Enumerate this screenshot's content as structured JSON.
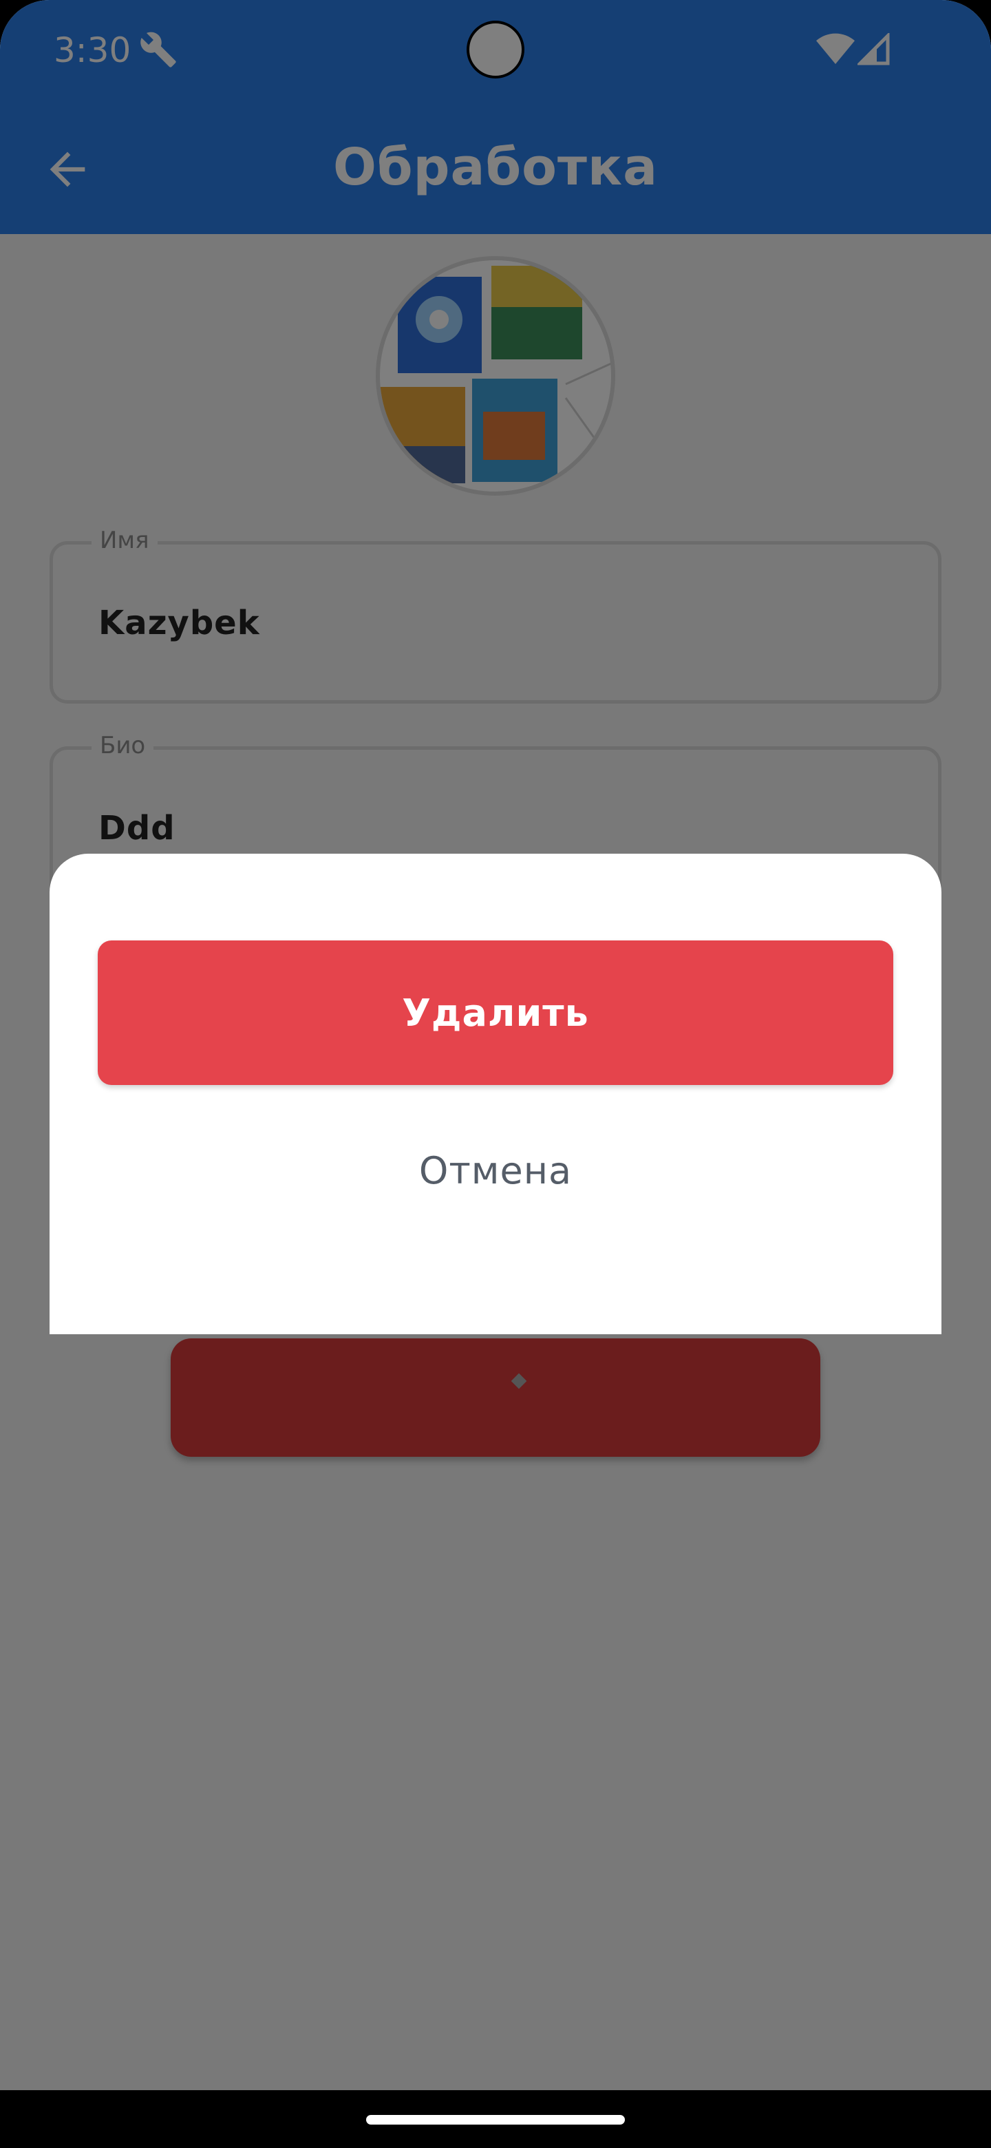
{
  "status_bar": {
    "time": "3:30",
    "icons": [
      "wrench-icon",
      "wifi-icon",
      "signal-icon"
    ]
  },
  "app_bar": {
    "title": "Обработка",
    "back_icon": "arrow-left-icon",
    "color": "#2a7fe9"
  },
  "profile": {
    "fields": [
      {
        "label": "Имя",
        "value": "Kazybek"
      },
      {
        "label": "Био",
        "value": "Ddd"
      }
    ]
  },
  "dialog": {
    "delete_label": "Удалить",
    "cancel_label": "Отмена",
    "delete_color": "#e5444c"
  }
}
